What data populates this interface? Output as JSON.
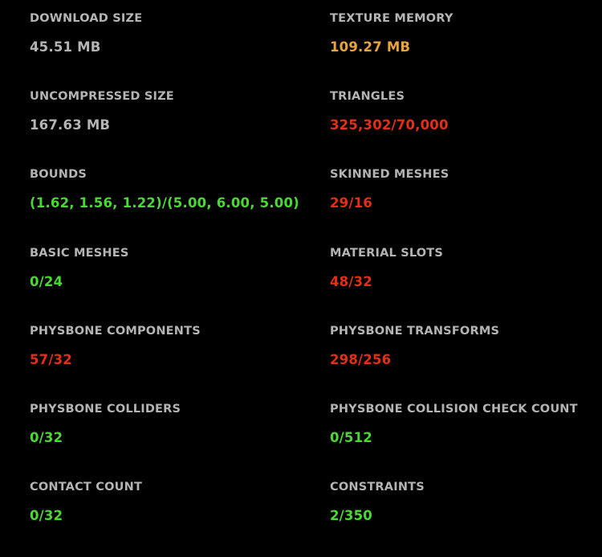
{
  "colors": {
    "background": "#000000",
    "label": "#b4b4b4",
    "neutral": "#b4b4b4",
    "ok": "#4bd834",
    "warn": "#e9a53d",
    "bad": "#e52e16"
  },
  "stats": [
    {
      "label": "DOWNLOAD SIZE",
      "value": "45.51 MB",
      "status": "neutral"
    },
    {
      "label": "TEXTURE MEMORY",
      "value": "109.27 MB",
      "status": "warn"
    },
    {
      "label": "UNCOMPRESSED SIZE",
      "value": "167.63 MB",
      "status": "neutral"
    },
    {
      "label": "TRIANGLES",
      "value": "325,302/70,000",
      "status": "bad"
    },
    {
      "label": "BOUNDS",
      "value": "(1.62, 1.56, 1.22)/(5.00, 6.00, 5.00)",
      "status": "ok"
    },
    {
      "label": "SKINNED MESHES",
      "value": "29/16",
      "status": "bad"
    },
    {
      "label": "BASIC MESHES",
      "value": "0/24",
      "status": "ok"
    },
    {
      "label": "MATERIAL SLOTS",
      "value": "48/32",
      "status": "bad"
    },
    {
      "label": "PHYSBONE COMPONENTS",
      "value": "57/32",
      "status": "bad"
    },
    {
      "label": "PHYSBONE TRANSFORMS",
      "value": "298/256",
      "status": "bad"
    },
    {
      "label": "PHYSBONE COLLIDERS",
      "value": "0/32",
      "status": "ok"
    },
    {
      "label": "PHYSBONE COLLISION CHECK COUNT",
      "value": "0/512",
      "status": "ok"
    },
    {
      "label": "CONTACT COUNT",
      "value": "0/32",
      "status": "ok"
    },
    {
      "label": "CONSTRAINTS",
      "value": "2/350",
      "status": "ok"
    }
  ]
}
